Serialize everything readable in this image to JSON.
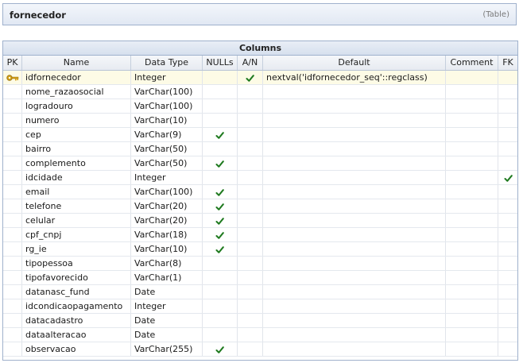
{
  "table": {
    "name": "fornecedor",
    "kind": "(Table)"
  },
  "section_title": "Columns",
  "columns": {
    "pk": "PK",
    "name": "Name",
    "type": "Data Type",
    "nulls": "NULLs",
    "an": "A/N",
    "default": "Default",
    "comment": "Comment",
    "fk": "FK"
  },
  "rows": [
    {
      "name": "idfornecedor",
      "type": "Integer",
      "pk": true,
      "nulls": false,
      "an": true,
      "default": "nextval('idfornecedor_seq'::regclass)",
      "comment": "",
      "fk": false
    },
    {
      "name": "nome_razaosocial",
      "type": "VarChar(100)",
      "pk": false,
      "nulls": false,
      "an": false,
      "default": "",
      "comment": "",
      "fk": false
    },
    {
      "name": "logradouro",
      "type": "VarChar(100)",
      "pk": false,
      "nulls": false,
      "an": false,
      "default": "",
      "comment": "",
      "fk": false
    },
    {
      "name": "numero",
      "type": "VarChar(10)",
      "pk": false,
      "nulls": false,
      "an": false,
      "default": "",
      "comment": "",
      "fk": false
    },
    {
      "name": "cep",
      "type": "VarChar(9)",
      "pk": false,
      "nulls": true,
      "an": false,
      "default": "",
      "comment": "",
      "fk": false
    },
    {
      "name": "bairro",
      "type": "VarChar(50)",
      "pk": false,
      "nulls": false,
      "an": false,
      "default": "",
      "comment": "",
      "fk": false
    },
    {
      "name": "complemento",
      "type": "VarChar(50)",
      "pk": false,
      "nulls": true,
      "an": false,
      "default": "",
      "comment": "",
      "fk": false
    },
    {
      "name": "idcidade",
      "type": "Integer",
      "pk": false,
      "nulls": false,
      "an": false,
      "default": "",
      "comment": "",
      "fk": true
    },
    {
      "name": "email",
      "type": "VarChar(100)",
      "pk": false,
      "nulls": true,
      "an": false,
      "default": "",
      "comment": "",
      "fk": false
    },
    {
      "name": "telefone",
      "type": "VarChar(20)",
      "pk": false,
      "nulls": true,
      "an": false,
      "default": "",
      "comment": "",
      "fk": false
    },
    {
      "name": "celular",
      "type": "VarChar(20)",
      "pk": false,
      "nulls": true,
      "an": false,
      "default": "",
      "comment": "",
      "fk": false
    },
    {
      "name": "cpf_cnpj",
      "type": "VarChar(18)",
      "pk": false,
      "nulls": true,
      "an": false,
      "default": "",
      "comment": "",
      "fk": false
    },
    {
      "name": "rg_ie",
      "type": "VarChar(10)",
      "pk": false,
      "nulls": true,
      "an": false,
      "default": "",
      "comment": "",
      "fk": false
    },
    {
      "name": "tipopessoa",
      "type": "VarChar(8)",
      "pk": false,
      "nulls": false,
      "an": false,
      "default": "",
      "comment": "",
      "fk": false
    },
    {
      "name": "tipofavorecido",
      "type": "VarChar(1)",
      "pk": false,
      "nulls": false,
      "an": false,
      "default": "",
      "comment": "",
      "fk": false
    },
    {
      "name": "datanasc_fund",
      "type": "Date",
      "pk": false,
      "nulls": false,
      "an": false,
      "default": "",
      "comment": "",
      "fk": false
    },
    {
      "name": "idcondicaopagamento",
      "type": "Integer",
      "pk": false,
      "nulls": false,
      "an": false,
      "default": "",
      "comment": "",
      "fk": false
    },
    {
      "name": "datacadastro",
      "type": "Date",
      "pk": false,
      "nulls": false,
      "an": false,
      "default": "",
      "comment": "",
      "fk": false
    },
    {
      "name": "dataalteracao",
      "type": "Date",
      "pk": false,
      "nulls": false,
      "an": false,
      "default": "",
      "comment": "",
      "fk": false
    },
    {
      "name": "observacao",
      "type": "VarChar(255)",
      "pk": false,
      "nulls": true,
      "an": false,
      "default": "",
      "comment": "",
      "fk": false
    }
  ],
  "icons": {
    "check": "check-icon",
    "key": "key-icon"
  },
  "colors": {
    "check": "#1f7a1f",
    "key": "#d4a017",
    "pk_row": "#fdfbe6",
    "border": "#9fb1cc"
  }
}
